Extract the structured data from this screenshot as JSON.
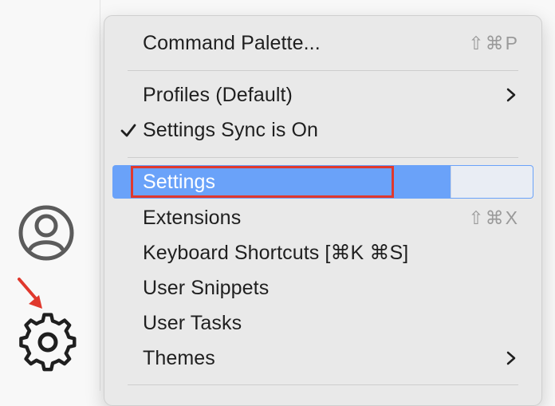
{
  "menu": {
    "items": [
      {
        "label": "Command Palette...",
        "shortcut": "⇧⌘P"
      },
      {
        "label": "Profiles (Default)",
        "has_submenu": true
      },
      {
        "label": "Settings Sync is On",
        "checked": true
      },
      {
        "label": "Settings",
        "selected": true,
        "highlighted": true
      },
      {
        "label": "Extensions",
        "shortcut": "⇧⌘X"
      },
      {
        "label": "Keyboard Shortcuts [⌘K ⌘S]"
      },
      {
        "label": "User Snippets"
      },
      {
        "label": "User Tasks"
      },
      {
        "label": "Themes",
        "has_submenu": true
      }
    ]
  },
  "icons": {
    "account": "account-icon",
    "gear": "gear-icon",
    "arrow": "arrow-icon",
    "chevron": "chevron-right-icon",
    "check": "checkmark-icon"
  },
  "colors": {
    "selected_bg": "#6aa2f9",
    "highlight_border": "#e0382d",
    "arrow": "#e0382d",
    "menu_bg": "#e9e9e9",
    "text": "#1f1f1f",
    "shortcut": "#9a9a9a"
  }
}
